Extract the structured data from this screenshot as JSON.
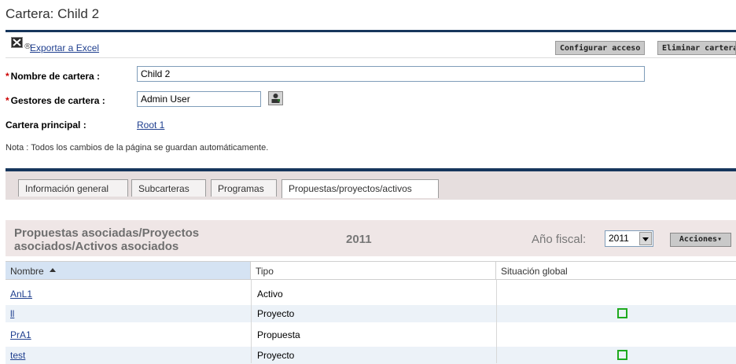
{
  "page": {
    "title": "Cartera: Child 2"
  },
  "toolbar": {
    "registered_mark": "®",
    "export_link": "Exportar a Excel",
    "configure_button": "Configurar acceso",
    "delete_button": "Eliminar cartera"
  },
  "form": {
    "required_mark": "*",
    "name_label": "Nombre de cartera :",
    "name_value": "Child 2",
    "managers_label": "Gestores de cartera :",
    "managers_value": "Admin User",
    "parent_label": "Cartera principal :",
    "parent_value": "Root 1",
    "note": "Nota : Todos los cambios de la página se guardan automáticamente."
  },
  "tabs": [
    {
      "label": "Información general"
    },
    {
      "label": "Subcarteras"
    },
    {
      "label": "Programas"
    },
    {
      "label": "Propuestas/proyectos/activos",
      "active": true
    }
  ],
  "panel": {
    "title_line1": "Propuestas asociadas/Proyectos",
    "title_line2": "asociados/Activos asociados",
    "year": "2011",
    "fiscal_year_label": "Año fiscal:",
    "fiscal_year_value": "2011",
    "actions_button": "Acciones▾"
  },
  "table": {
    "columns": [
      "Nombre",
      "Tipo",
      "Situación global"
    ],
    "sorted_column": "Nombre",
    "rows": [
      {
        "name": "AnL1",
        "type": "Activo",
        "status": ""
      },
      {
        "name": "ll",
        "type": "Proyecto",
        "status": "green"
      },
      {
        "name": "PrA1",
        "type": "Propuesta",
        "status": ""
      },
      {
        "name": "test",
        "type": "Proyecto",
        "status": "green"
      }
    ]
  },
  "colors": {
    "accent_rule": "#16365c",
    "status_green": "#1faa1f",
    "link": "#1f3f8f"
  }
}
